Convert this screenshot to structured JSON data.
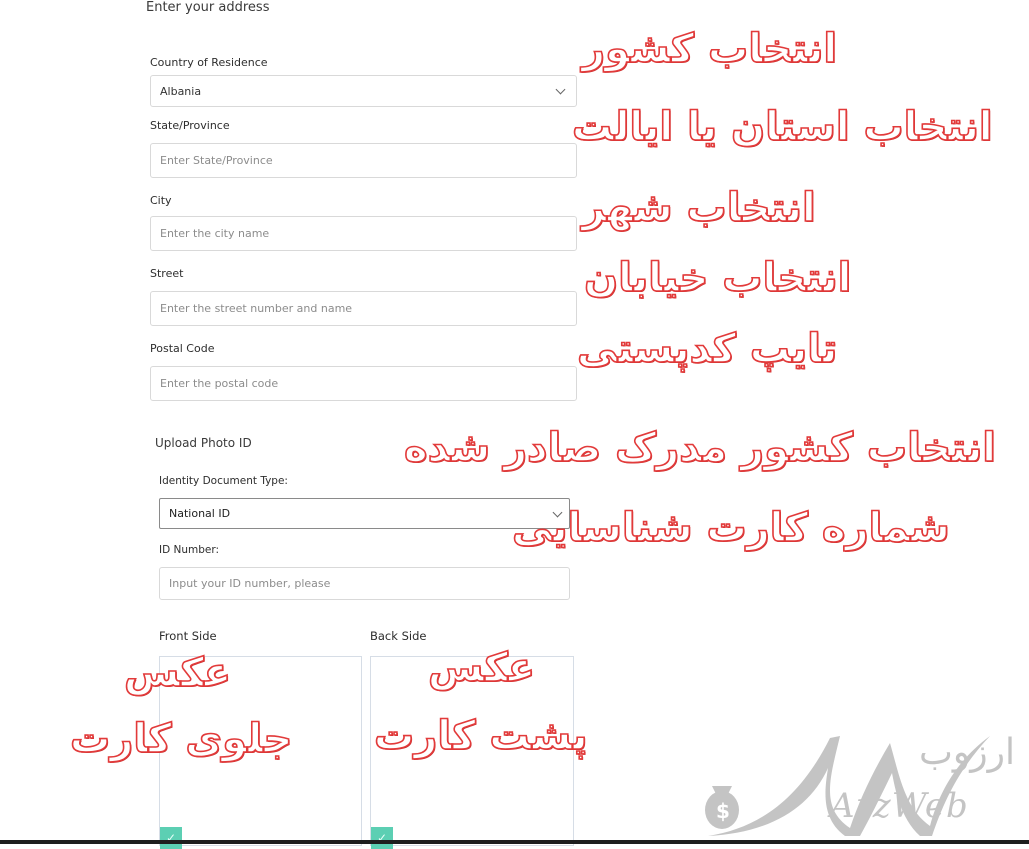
{
  "address_section": {
    "title": "Enter your address",
    "country": {
      "label": "Country of Residence",
      "value": "Albania"
    },
    "state": {
      "label": "State/Province",
      "placeholder": "Enter State/Province"
    },
    "city": {
      "label": "City",
      "placeholder": "Enter the city name"
    },
    "street": {
      "label": "Street",
      "placeholder": "Enter the street number and name"
    },
    "postal": {
      "label": "Postal Code",
      "placeholder": "Enter the postal code"
    }
  },
  "id_section": {
    "title": "Upload Photo ID",
    "doc_type": {
      "label": "Identity Document Type:",
      "value": "National ID"
    },
    "id_number": {
      "label": "ID Number:",
      "placeholder": "Input your ID number, please"
    },
    "front": {
      "label": "Front Side",
      "check_icon": "check-icon"
    },
    "back": {
      "label": "Back Side",
      "check_icon": "check-icon"
    }
  },
  "annotations": {
    "select_country": "انتخاب کشور",
    "select_state": "انتخاب استان یا ایالت",
    "select_city": "انتخاب شهر",
    "select_street": "انتخاب خیابان",
    "type_postal": "تایپ کدپستی",
    "select_issuing_country": "انتخاب کشور مدرک صادر شده",
    "id_card_number": "شماره کارت شناسایی",
    "front_photo_line1": "عکس",
    "front_photo_line2": "جلوی کارت",
    "back_photo_line1": "عکس",
    "back_photo_line2": "پشت کارت",
    "color": "#e23a3a"
  },
  "watermark": {
    "persian": "ارزوب",
    "latin": "ArzWeb"
  },
  "colors": {
    "check_badge": "#5ccfb3"
  }
}
